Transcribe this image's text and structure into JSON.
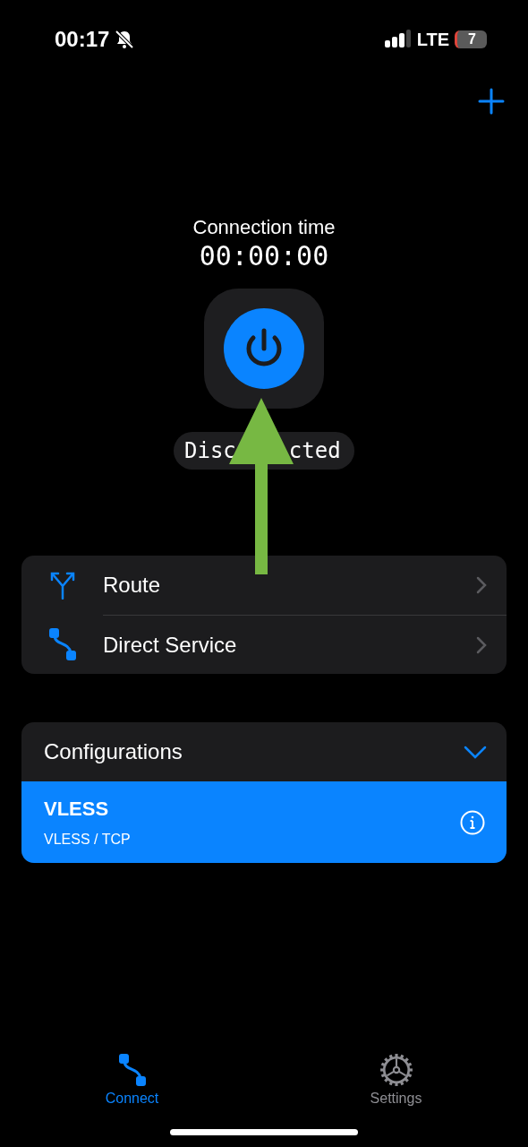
{
  "status_bar": {
    "time": "00:17",
    "network": "LTE",
    "battery": "7"
  },
  "connection": {
    "label": "Connection time",
    "time": "00:00:00",
    "status_parts": [
      "Disc",
      "cted"
    ]
  },
  "menu": [
    {
      "kind": "route",
      "label": "Route"
    },
    {
      "kind": "direct",
      "label": "Direct Service"
    }
  ],
  "configurations": {
    "title": "Configurations",
    "expanded": true,
    "items": [
      {
        "name": "VLESS",
        "detail": "VLESS / TCP",
        "selected": true
      }
    ]
  },
  "tabs": [
    {
      "kind": "connect",
      "label": "Connect",
      "selected": true
    },
    {
      "kind": "settings",
      "label": "Settings",
      "selected": false
    }
  ]
}
